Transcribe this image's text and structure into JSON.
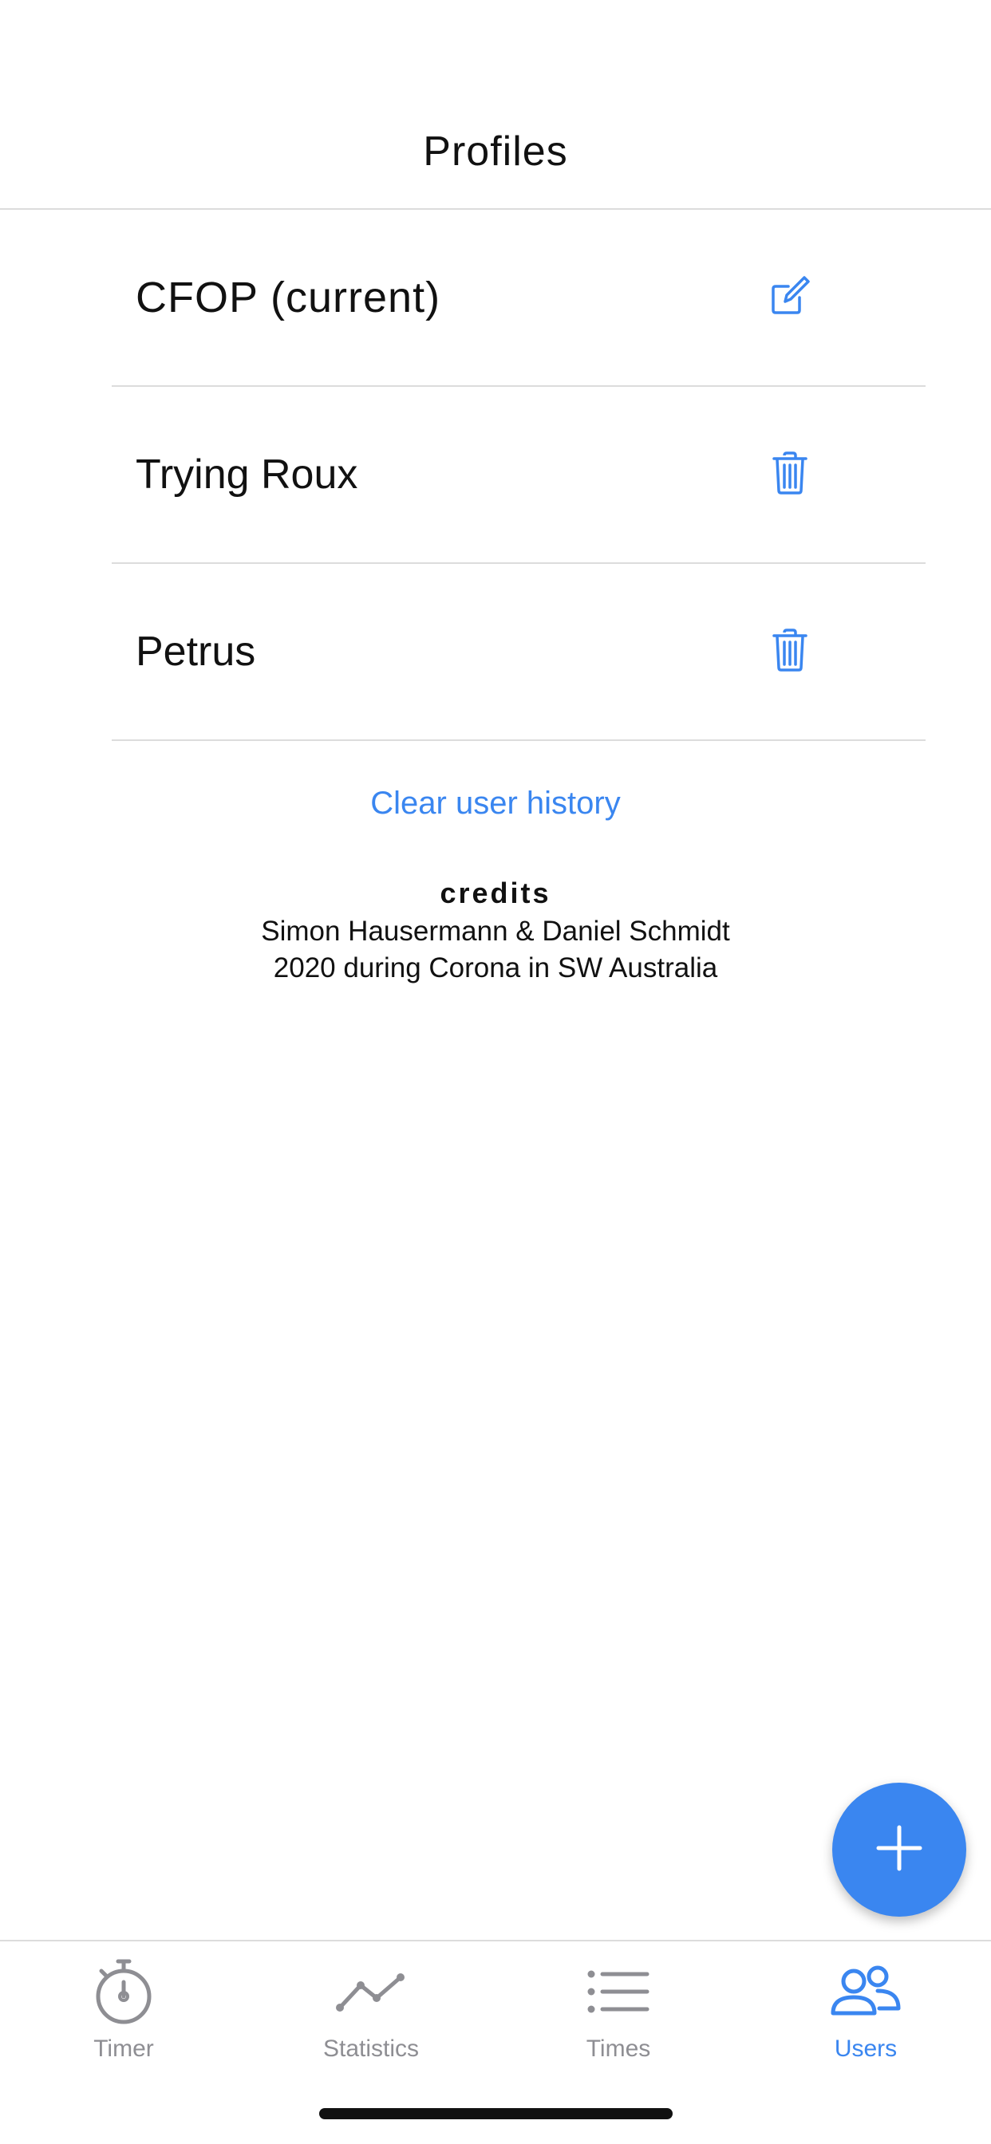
{
  "header": {
    "title": "Profiles"
  },
  "profiles": [
    {
      "name": "CFOP (current)",
      "action": "edit-icon"
    },
    {
      "name": "Trying Roux",
      "action": "trash-icon"
    },
    {
      "name": "Petrus",
      "action": "trash-icon"
    }
  ],
  "clear_history_label": "Clear user history",
  "credits": {
    "title": "credits",
    "line1": "Simon Hausermann & Daniel Schmidt",
    "line2": "2020 during Corona in SW Australia"
  },
  "fab": {
    "icon": "plus-icon"
  },
  "tabs": [
    {
      "label": "Timer",
      "icon": "stopwatch-icon",
      "active": false
    },
    {
      "label": "Statistics",
      "icon": "line-chart-icon",
      "active": false
    },
    {
      "label": "Times",
      "icon": "list-icon",
      "active": false
    },
    {
      "label": "Users",
      "icon": "users-icon",
      "active": true
    }
  ],
  "colors": {
    "accent": "#3a86f0",
    "inactive": "#8e8e93",
    "text": "#111111",
    "divider": "#dcdcdc"
  }
}
